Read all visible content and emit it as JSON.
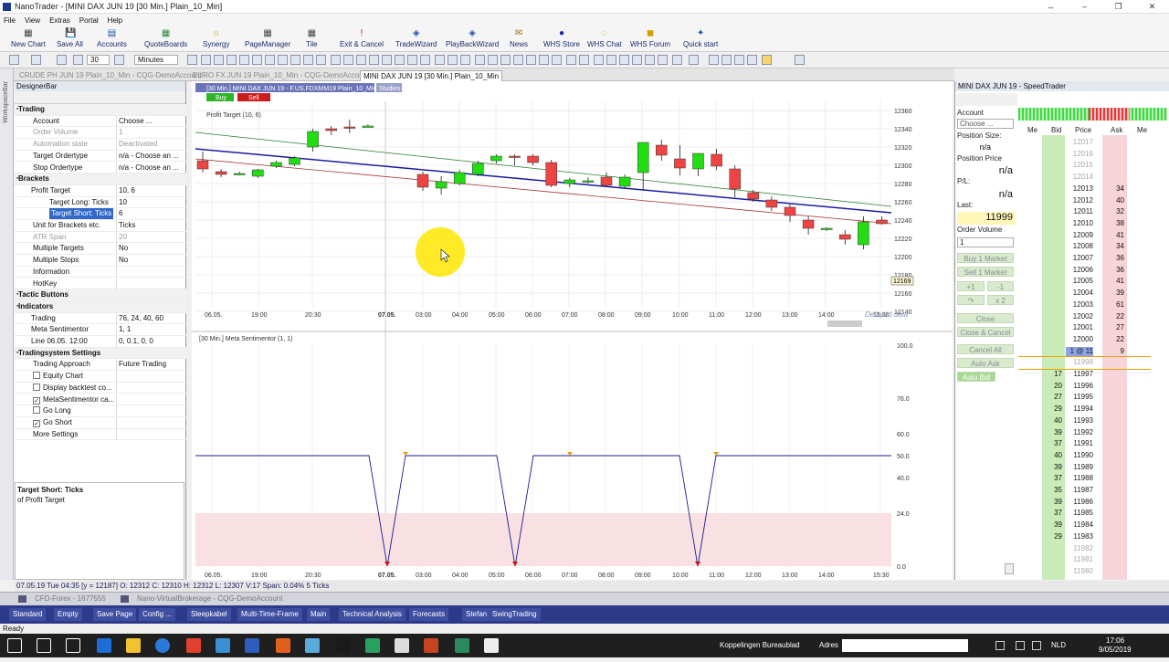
{
  "window": {
    "title": "NanoTrader - [MINI DAX JUN 19 [30 Min.]  Plain_10_Min]",
    "controls": [
      "↔",
      "–",
      "❐",
      "✕"
    ]
  },
  "menu": [
    "File",
    "View",
    "Extras",
    "Portal",
    "Help"
  ],
  "ribbon": [
    "New Chart",
    "Save All",
    "Accounts",
    "QuoteBoards",
    "Synergy",
    "PageManager",
    "Tile",
    "Exit & Cancel",
    "TradeWizard",
    "PlayBackWizard",
    "News",
    "WHS Store",
    "WHS Chat",
    "WHS Forum",
    "Quick start"
  ],
  "toolbar2": {
    "interval_value": "30",
    "interval_unit": "Minutes"
  },
  "doc_tabs": [
    {
      "label": "CRUDE PH JUN 19  Plain_10_Min - CQG-DemoAccount",
      "active": false
    },
    {
      "label": "EURO FX JUN 19  Plain_10_Min - CQG-DemoAccount",
      "active": false
    },
    {
      "label": "MINI DAX JUN 19 [30 Min.]  Plain_10_Min",
      "active": true
    }
  ],
  "workspace_label": "WorkspaceBar",
  "designer": {
    "title": "DesignerBar",
    "rows": [
      {
        "k": "Trading",
        "v": "",
        "t": "cat"
      },
      {
        "k": "Account",
        "v": "Choose ...",
        "t": ""
      },
      {
        "k": "Order Volume",
        "v": "1",
        "t": "gray"
      },
      {
        "k": "Automation state",
        "v": "Deactivated",
        "t": "gray"
      },
      {
        "k": "Target Ordertype",
        "v": "n/a - Choose an ...",
        "t": ""
      },
      {
        "k": "Stop Ordertype",
        "v": "n/a - Choose an ...",
        "t": ""
      },
      {
        "k": "Brackets",
        "v": "",
        "t": "cat"
      },
      {
        "k": "Profit Target",
        "v": "10, 6",
        "t": "sub"
      },
      {
        "k": "Target Long: Ticks",
        "v": "10",
        "t": "sub2"
      },
      {
        "k": "Target Short: Ticks",
        "v": "6",
        "t": "sel"
      },
      {
        "k": "Unit for Brackets etc.",
        "v": "Ticks",
        "t": ""
      },
      {
        "k": "ATR Span",
        "v": "20",
        "t": "gray"
      },
      {
        "k": "Multiple Targets",
        "v": "No",
        "t": ""
      },
      {
        "k": "Multiple Stops",
        "v": "No",
        "t": ""
      },
      {
        "k": "Information",
        "v": "",
        "t": ""
      },
      {
        "k": "HotKey",
        "v": "",
        "t": ""
      },
      {
        "k": "Tactic Buttons",
        "v": "",
        "t": "cat"
      },
      {
        "k": "Indicators",
        "v": "",
        "t": "cat"
      },
      {
        "k": "Trading",
        "v": "76, 24, 40, 60",
        "t": "sub"
      },
      {
        "k": "Meta Sentimentor",
        "v": "1, 1",
        "t": "sub"
      },
      {
        "k": "Line 06.05. 12:00",
        "v": "0, 0.1, 0, 0",
        "t": "sub"
      },
      {
        "k": "Tradingsystem Settings",
        "v": "",
        "t": "cat"
      },
      {
        "k": "Trading Approach",
        "v": "Future Trading",
        "t": ""
      },
      {
        "k": "Equity Chart",
        "v": "",
        "t": "cb0"
      },
      {
        "k": "Display backtest co...",
        "v": "",
        "t": "cb0"
      },
      {
        "k": "MetaSentimentor ca...",
        "v": "",
        "t": "cb1"
      },
      {
        "k": "Go Long",
        "v": "",
        "t": "cb0"
      },
      {
        "k": "Go Short",
        "v": "",
        "t": "cb1"
      },
      {
        "k": "More Settings",
        "v": "",
        "t": ""
      }
    ],
    "desc_title": "Target Short: Ticks",
    "desc_text": "of Profit Target"
  },
  "chart": {
    "header": "[30 Min.] MINI DAX JUN 19 - F.US.FDXMM19 Plain_10_Min",
    "studies_label": "Studies",
    "buy_label": "Buy",
    "sell_label": "Sell",
    "overlay_label": "Profit Target  (10, 6)",
    "last_price_tag": "12169",
    "delayed_label": "Delayed data",
    "time_labels": [
      "06.05.",
      "19:00",
      "20:30",
      "07.05.",
      "03:00",
      "04:00",
      "05:00",
      "06:00",
      "07:00",
      "08:00",
      "09:00",
      "10:00",
      "11:00",
      "12:00",
      "13:00",
      "14:00",
      "15:30"
    ],
    "price_ticks": [
      "12360",
      "12340",
      "12320",
      "12300",
      "12280",
      "12260",
      "12240",
      "12220",
      "12200",
      "12180",
      "12160",
      "12140"
    ],
    "indicator_header": "[30 Min.] Meta Sentimentor  (1, 1)",
    "indicator_ticks": [
      "100.0",
      "76.0",
      "60.0",
      "50.0",
      "40.0",
      "24.0",
      "0.0"
    ]
  },
  "chart_data": {
    "type": "candlestick",
    "instrument": "MINI DAX JUN 19",
    "interval": "30 Min.",
    "ylim": [
      12140,
      12370
    ],
    "candles": [
      [
        12305,
        12315,
        12292,
        12296
      ],
      [
        12293,
        12296,
        12287,
        12290
      ],
      [
        12291,
        12293,
        12289,
        12291
      ],
      [
        12288,
        12296,
        12286,
        12295
      ],
      [
        12299,
        12305,
        12297,
        12303
      ],
      [
        12301,
        12310,
        12299,
        12308
      ],
      [
        12320,
        12340,
        12315,
        12337
      ],
      [
        12340,
        12343,
        12333,
        12338
      ],
      [
        12342,
        12350,
        12335,
        12341
      ],
      [
        12343,
        12345,
        12342,
        12343
      ],
      [
        12290,
        12293,
        12272,
        12276
      ],
      [
        12275,
        12288,
        12268,
        12282
      ],
      [
        12280,
        12295,
        12278,
        12292
      ],
      [
        12290,
        12305,
        12288,
        12302
      ],
      [
        12305,
        12312,
        12302,
        12310
      ],
      [
        12310,
        12312,
        12300,
        12309
      ],
      [
        12310,
        12312,
        12300,
        12303
      ],
      [
        12303,
        12306,
        12276,
        12278
      ],
      [
        12280,
        12286,
        12276,
        12284
      ],
      [
        12283,
        12287,
        12280,
        12283
      ],
      [
        12287,
        12292,
        12276,
        12278
      ],
      [
        12277,
        12290,
        12274,
        12287
      ],
      [
        12292,
        12325,
        12272,
        12325
      ],
      [
        12322,
        12328,
        12305,
        12311
      ],
      [
        12307,
        12322,
        12289,
        12297
      ],
      [
        12296,
        12313,
        12288,
        12313
      ],
      [
        12312,
        12318,
        12295,
        12299
      ],
      [
        12296,
        12300,
        12265,
        12274
      ],
      [
        12270,
        12273,
        12260,
        12263
      ],
      [
        12262,
        12266,
        12250,
        12254
      ],
      [
        12254,
        12257,
        12238,
        12245
      ],
      [
        12240,
        12244,
        12224,
        12231
      ],
      [
        12230,
        12232,
        12228,
        12231
      ],
      [
        12224,
        12229,
        12213,
        12219
      ],
      [
        12213,
        12244,
        12208,
        12238
      ],
      [
        12240,
        12244,
        12235,
        12236
      ],
      [
        12232,
        12240,
        12212,
        12215
      ],
      [
        12205,
        12214,
        12165,
        12180
      ]
    ],
    "indicator": {
      "name": "Meta Sentimentor",
      "ylim": [
        0,
        100
      ],
      "levels": [
        76,
        60,
        50,
        40,
        24
      ]
    }
  },
  "speed": {
    "title": "MINI DAX JUN 19 - SpeedTrader",
    "account_label": "Account",
    "account_value": "Choose ...",
    "pos_size_label": "Position Size:",
    "pos_size": "n/a",
    "pos_price_label": "Position Price",
    "pos_price": "n/a",
    "pl_label": "P/L:",
    "pl": "n/a",
    "last_label": "Last:",
    "last": "11999",
    "ov_label": "Order Volume",
    "ov": "1",
    "buttons": [
      "Buy 1 Market",
      "Sell 1 Market",
      "+1",
      "-1",
      "↷",
      "x 2",
      "Close",
      "Close & Cancel",
      "Cancel All",
      "Auto Ask",
      "Auto Bid"
    ],
    "col_headers": [
      "Me",
      "Bid",
      "Price",
      "Ask",
      "Me"
    ],
    "ladder": [
      {
        "bid": "",
        "price": "12017",
        "ask": ""
      },
      {
        "bid": "",
        "price": "12016",
        "ask": ""
      },
      {
        "bid": "",
        "price": "12015",
        "ask": ""
      },
      {
        "bid": "",
        "price": "12014",
        "ask": ""
      },
      {
        "bid": "",
        "price": "12013",
        "ask": "34"
      },
      {
        "bid": "",
        "price": "12012",
        "ask": "40"
      },
      {
        "bid": "",
        "price": "12011",
        "ask": "32"
      },
      {
        "bid": "",
        "price": "12010",
        "ask": "38"
      },
      {
        "bid": "",
        "price": "12009",
        "ask": "41"
      },
      {
        "bid": "",
        "price": "12008",
        "ask": "34"
      },
      {
        "bid": "",
        "price": "12007",
        "ask": "36"
      },
      {
        "bid": "",
        "price": "12006",
        "ask": "36"
      },
      {
        "bid": "",
        "price": "12005",
        "ask": "41"
      },
      {
        "bid": "",
        "price": "12004",
        "ask": "39"
      },
      {
        "bid": "",
        "price": "12003",
        "ask": "61"
      },
      {
        "bid": "",
        "price": "12002",
        "ask": "22"
      },
      {
        "bid": "",
        "price": "12001",
        "ask": "27"
      },
      {
        "bid": "",
        "price": "12000",
        "ask": "22"
      },
      {
        "bid": "",
        "price": "1 @ 11",
        "ask": "9"
      },
      {
        "bid": "",
        "price": "11998",
        "ask": ""
      },
      {
        "bid": "17",
        "price": "11997",
        "ask": ""
      },
      {
        "bid": "20",
        "price": "11996",
        "ask": ""
      },
      {
        "bid": "27",
        "price": "11995",
        "ask": ""
      },
      {
        "bid": "29",
        "price": "11994",
        "ask": ""
      },
      {
        "bid": "40",
        "price": "11993",
        "ask": ""
      },
      {
        "bid": "39",
        "price": "11992",
        "ask": ""
      },
      {
        "bid": "37",
        "price": "11991",
        "ask": ""
      },
      {
        "bid": "40",
        "price": "11990",
        "ask": ""
      },
      {
        "bid": "39",
        "price": "11989",
        "ask": ""
      },
      {
        "bid": "37",
        "price": "11988",
        "ask": ""
      },
      {
        "bid": "35",
        "price": "11987",
        "ask": ""
      },
      {
        "bid": "39",
        "price": "11986",
        "ask": ""
      },
      {
        "bid": "37",
        "price": "11985",
        "ask": ""
      },
      {
        "bid": "39",
        "price": "11984",
        "ask": ""
      },
      {
        "bid": "29",
        "price": "11983",
        "ask": ""
      },
      {
        "bid": "",
        "price": "11982",
        "ask": ""
      },
      {
        "bid": "",
        "price": "11981",
        "ask": ""
      },
      {
        "bid": "",
        "price": "11980",
        "ask": ""
      }
    ]
  },
  "status_info": "07.05.19 Tue  04:35 [y = 12187]      O: 12312 C: 12310 H: 12312 L: 12307 V:17 Span: 0.04% 5 Ticks",
  "accounts": [
    "CFD-Forex - 1677555",
    "Nano-VirtualBrokerage - CQG-DemoAccount"
  ],
  "workspace_tabs": [
    "Standard",
    "Empty",
    "Save Page",
    "Config ...",
    "Sleepkabel",
    "Multi-Time-Frame",
    "Main",
    "Technical Analysis",
    "Forecasts",
    "Stefan",
    "SwingTrading"
  ],
  "statusbar": "Ready",
  "taskbar": {
    "links": "Koppelingen  Bureaublad",
    "addr_label": "Adres",
    "lang": "NLD",
    "time": "17:06",
    "date": "9/05/2019"
  },
  "colors": {
    "up": "#22dd11",
    "down": "#ee4444",
    "accent": "#2d3a8a",
    "ladder_green": "#c8ebb7",
    "ladder_pink": "#f7d4d9"
  }
}
